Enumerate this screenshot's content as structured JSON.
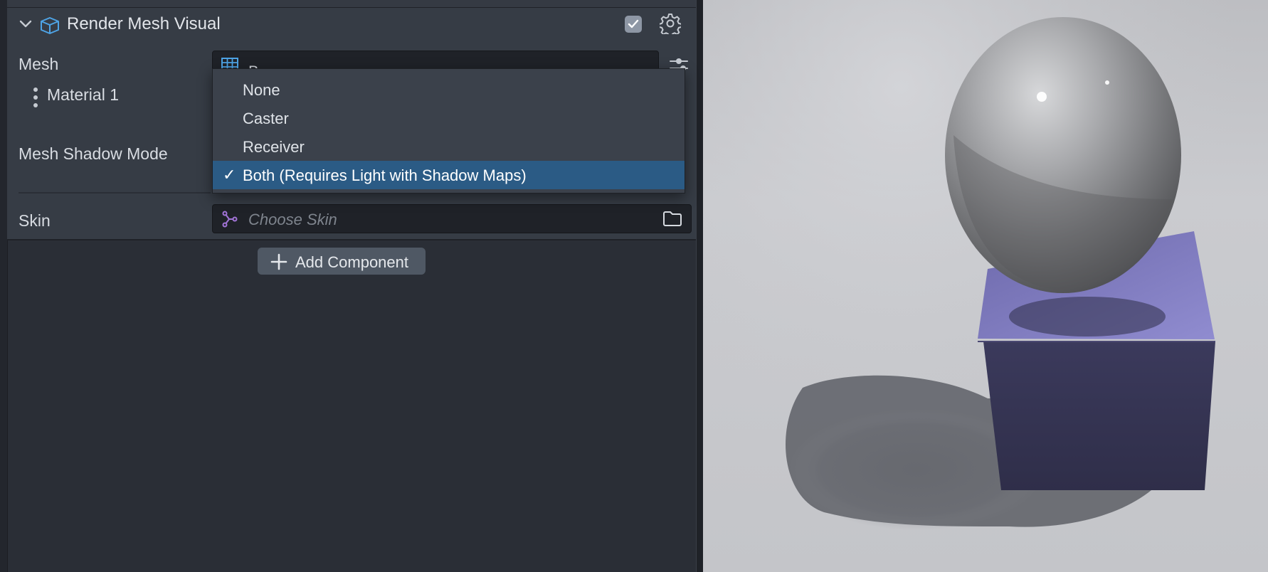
{
  "component": {
    "title": "Render Mesh Visual",
    "enabled": true
  },
  "properties": {
    "mesh_label": "Mesh",
    "mesh_value": "Box",
    "material_label": "Material 1",
    "shadow_mode_label": "Mesh Shadow Mode",
    "skin_label": "Skin",
    "skin_placeholder": "Choose Skin"
  },
  "dropdown": {
    "options": [
      "None",
      "Caster",
      "Receiver",
      "Both (Requires Light with Shadow Maps)"
    ],
    "selected": "Both (Requires Light with Shadow Maps)",
    "check_mark": "✓"
  },
  "add_component_label": "Add Component",
  "icons": {
    "collapse": "chevron-down-icon",
    "component": "cube-icon",
    "enable": "checkbox-icon",
    "settings": "gear-icon",
    "mesh": "mesh-grid-icon",
    "mesh_options": "slider-icon",
    "material_menu": "kebab-icon",
    "skin": "skeleton-icon",
    "skin_browse": "folder-icon",
    "add": "plus-icon"
  },
  "colors": {
    "panel": "#363c45",
    "background": "#2a2e36",
    "selection": "#2b5b85",
    "accent_blue": "#4ea4e6",
    "skin_purple": "#a274d8",
    "cube_purple": "#8b87c8"
  }
}
